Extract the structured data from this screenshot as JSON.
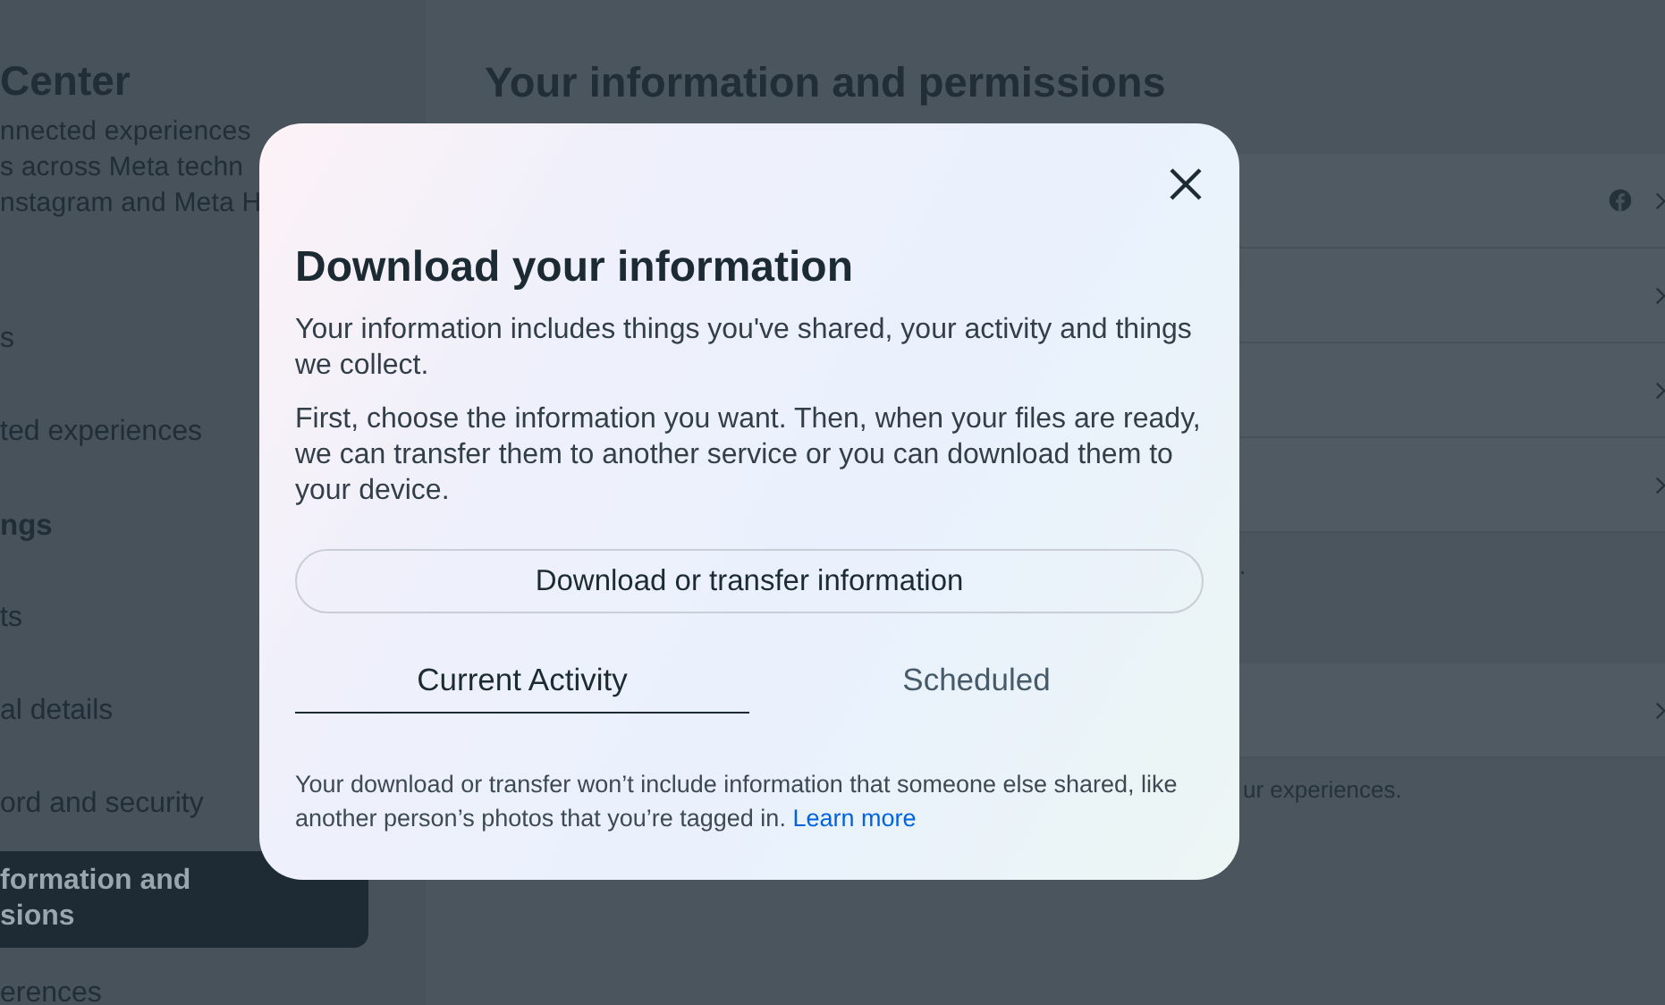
{
  "sidebar": {
    "title": "Center",
    "description_lines": [
      "nnected experiences",
      "s across Meta techn",
      "nstagram and Meta H"
    ],
    "items": [
      {
        "kind": "item",
        "label": "s",
        "selected": false
      },
      {
        "kind": "item",
        "label": "ted experiences",
        "selected": false
      },
      {
        "kind": "heading",
        "label": "ngs"
      },
      {
        "kind": "item",
        "label": "ts",
        "selected": false
      },
      {
        "kind": "item",
        "label": "al details",
        "selected": false
      },
      {
        "kind": "item",
        "label": "ord and security",
        "selected": false
      },
      {
        "kind": "item",
        "label": "formation and\nsions",
        "selected": true
      },
      {
        "kind": "item",
        "label": "erences",
        "selected": false
      }
    ]
  },
  "main": {
    "title": "Your information and permissions",
    "rows": [
      {
        "kind": "badge-link"
      },
      {
        "kind": "link"
      },
      {
        "kind": "link"
      },
      {
        "kind": "link"
      },
      {
        "kind": "note",
        "text": "."
      },
      {
        "kind": "link"
      },
      {
        "kind": "footnote",
        "text": "ur experiences."
      }
    ]
  },
  "dialog": {
    "title": "Download your information",
    "paragraphs": [
      "Your information includes things you've shared, your activity and things we collect.",
      "First, choose the information you want. Then, when your files are ready, we can transfer them to another service or you can download them to your device."
    ],
    "action": "Download or transfer information",
    "tabs": [
      {
        "label": "Current Activity",
        "selected": true
      },
      {
        "label": "Scheduled",
        "selected": false
      }
    ],
    "footer": "Your download or transfer won’t include information that someone else shared, like another person’s photos that you’re tagged in.",
    "footer_link": "Learn more"
  }
}
